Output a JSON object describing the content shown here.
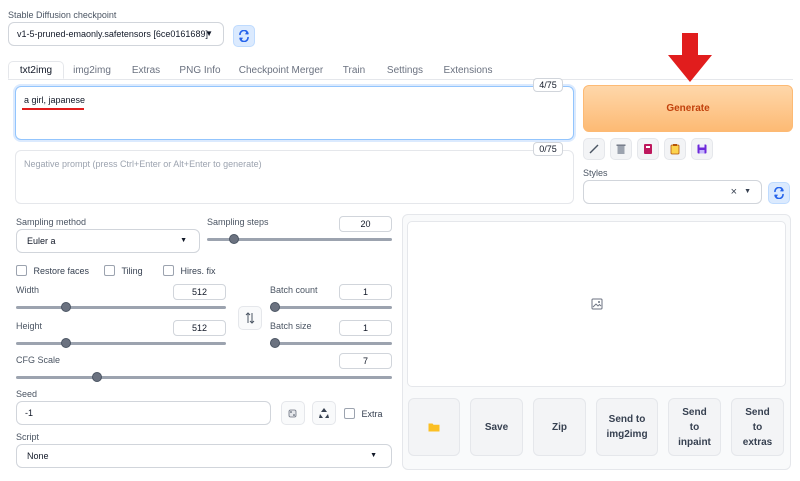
{
  "checkpoint": {
    "label": "Stable Diffusion checkpoint",
    "value": "v1-5-pruned-emaonly.safetensors [6ce0161689]"
  },
  "tabs": [
    "txt2img",
    "img2img",
    "Extras",
    "PNG Info",
    "Checkpoint Merger",
    "Train",
    "Settings",
    "Extensions"
  ],
  "prompt": {
    "value": "a girl, japanese",
    "counter": "4/75"
  },
  "negative_prompt": {
    "placeholder": "Negative prompt (press Ctrl+Enter or Alt+Enter to generate)",
    "counter": "0/75"
  },
  "generate": {
    "label": "Generate"
  },
  "styles": {
    "label": "Styles",
    "clear": "×"
  },
  "sampling": {
    "method_label": "Sampling method",
    "method_value": "Euler a",
    "steps_label": "Sampling steps",
    "steps_value": "20"
  },
  "checkboxes": {
    "restore_faces": "Restore faces",
    "tiling": "Tiling",
    "hires_fix": "Hires. fix"
  },
  "width": {
    "label": "Width",
    "value": "512"
  },
  "height": {
    "label": "Height",
    "value": "512"
  },
  "batch_count": {
    "label": "Batch count",
    "value": "1"
  },
  "batch_size": {
    "label": "Batch size",
    "value": "1"
  },
  "cfg_scale": {
    "label": "CFG Scale",
    "value": "7"
  },
  "seed": {
    "label": "Seed",
    "value": "-1",
    "extra_label": "Extra"
  },
  "script": {
    "label": "Script",
    "value": "None"
  },
  "gallery_buttons": {
    "save": "Save",
    "zip": "Zip",
    "send_img2img": [
      "Send to",
      "img2img"
    ],
    "send_inpaint": [
      "Send",
      "to",
      "inpaint"
    ],
    "send_extras": [
      "Send",
      "to",
      "extras"
    ]
  },
  "colors": {
    "generate_bg": "#fed7aa",
    "generate_text": "#c2410c",
    "annotation_red": "#e11d1d",
    "accent_blue": "#2563eb"
  }
}
